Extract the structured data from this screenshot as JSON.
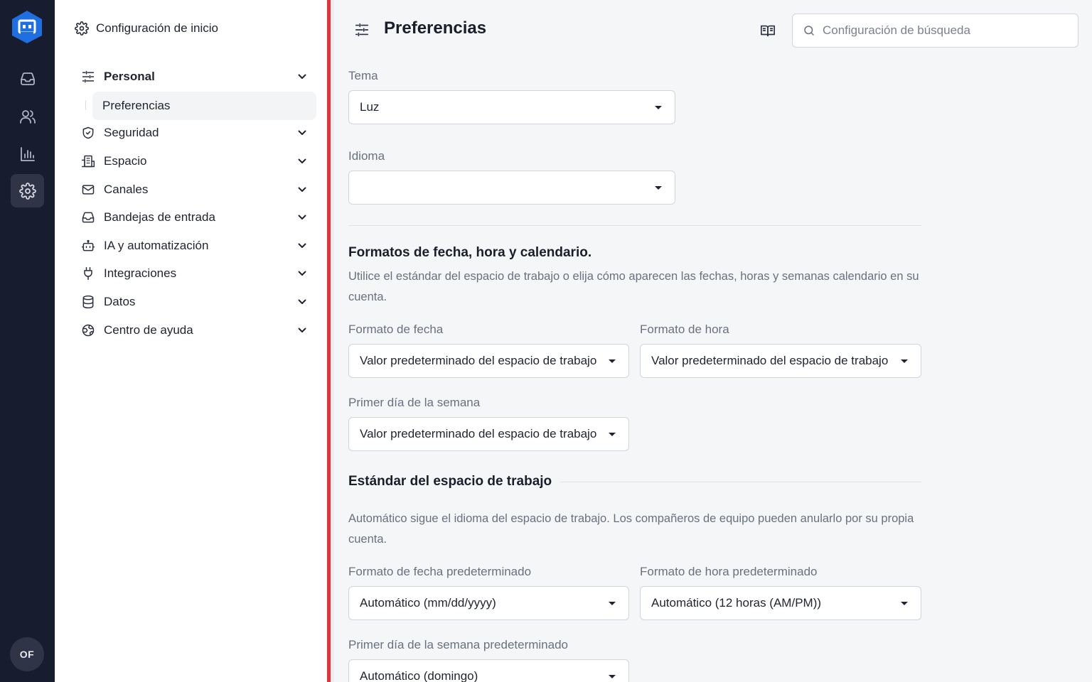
{
  "rail": {
    "items": [
      {
        "name": "inbox-icon"
      },
      {
        "name": "contacts-icon"
      },
      {
        "name": "reports-icon"
      },
      {
        "name": "settings-icon",
        "active": true
      }
    ],
    "avatar_initials": "OF"
  },
  "sidebar": {
    "home_label": "Configuración de inicio",
    "items": [
      {
        "label": "Personal",
        "icon": "sliders-icon",
        "expanded": true
      },
      {
        "label": "Seguridad",
        "icon": "shield-icon"
      },
      {
        "label": "Espacio",
        "icon": "building-icon"
      },
      {
        "label": "Canales",
        "icon": "mail-icon"
      },
      {
        "label": "Bandejas de entrada",
        "icon": "inbox-icon"
      },
      {
        "label": "IA y automatización",
        "icon": "bot-icon"
      },
      {
        "label": "Integraciones",
        "icon": "plug-icon"
      },
      {
        "label": "Datos",
        "icon": "database-icon"
      },
      {
        "label": "Centro de ayuda",
        "icon": "globe-icon"
      }
    ],
    "sub_item": "Preferencias"
  },
  "header": {
    "title": "Preferencias",
    "search_placeholder": "Configuración de búsqueda"
  },
  "form": {
    "theme_label": "Tema",
    "theme_value": "Luz",
    "language_label": "Idioma",
    "language_value": "",
    "formats_title": "Formatos de fecha, hora y calendario.",
    "formats_desc": "Utilice el estándar del espacio de trabajo o elija cómo aparecen las fechas, horas y semanas calendario en su cuenta.",
    "date_format_label": "Formato de fecha",
    "date_format_value": "Valor predeterminado del espacio de trabajo",
    "time_format_label": "Formato de hora",
    "time_format_value": "Valor predeterminado del espacio de trabajo",
    "first_day_label": "Primer día de la semana",
    "first_day_value": "Valor predeterminado del espacio de trabajo",
    "workspace_title": "Estándar del espacio de trabajo",
    "workspace_desc": "Automático sigue el idioma del espacio de trabajo. Los compañeros de equipo pueden anularlo por su propia cuenta.",
    "default_date_label": "Formato de fecha predeterminado",
    "default_date_value": "Automático (mm/dd/yyyy)",
    "default_time_label": "Formato de hora predeterminado",
    "default_time_value": "Automático (12 horas (AM/PM))",
    "default_first_day_label": "Primer día de la semana predeterminado",
    "default_first_day_value": "Automático (domingo)"
  },
  "colors": {
    "rail_bg": "#171c2e",
    "brand": "#1f6fe0",
    "accent_divider": "#e0353a"
  }
}
